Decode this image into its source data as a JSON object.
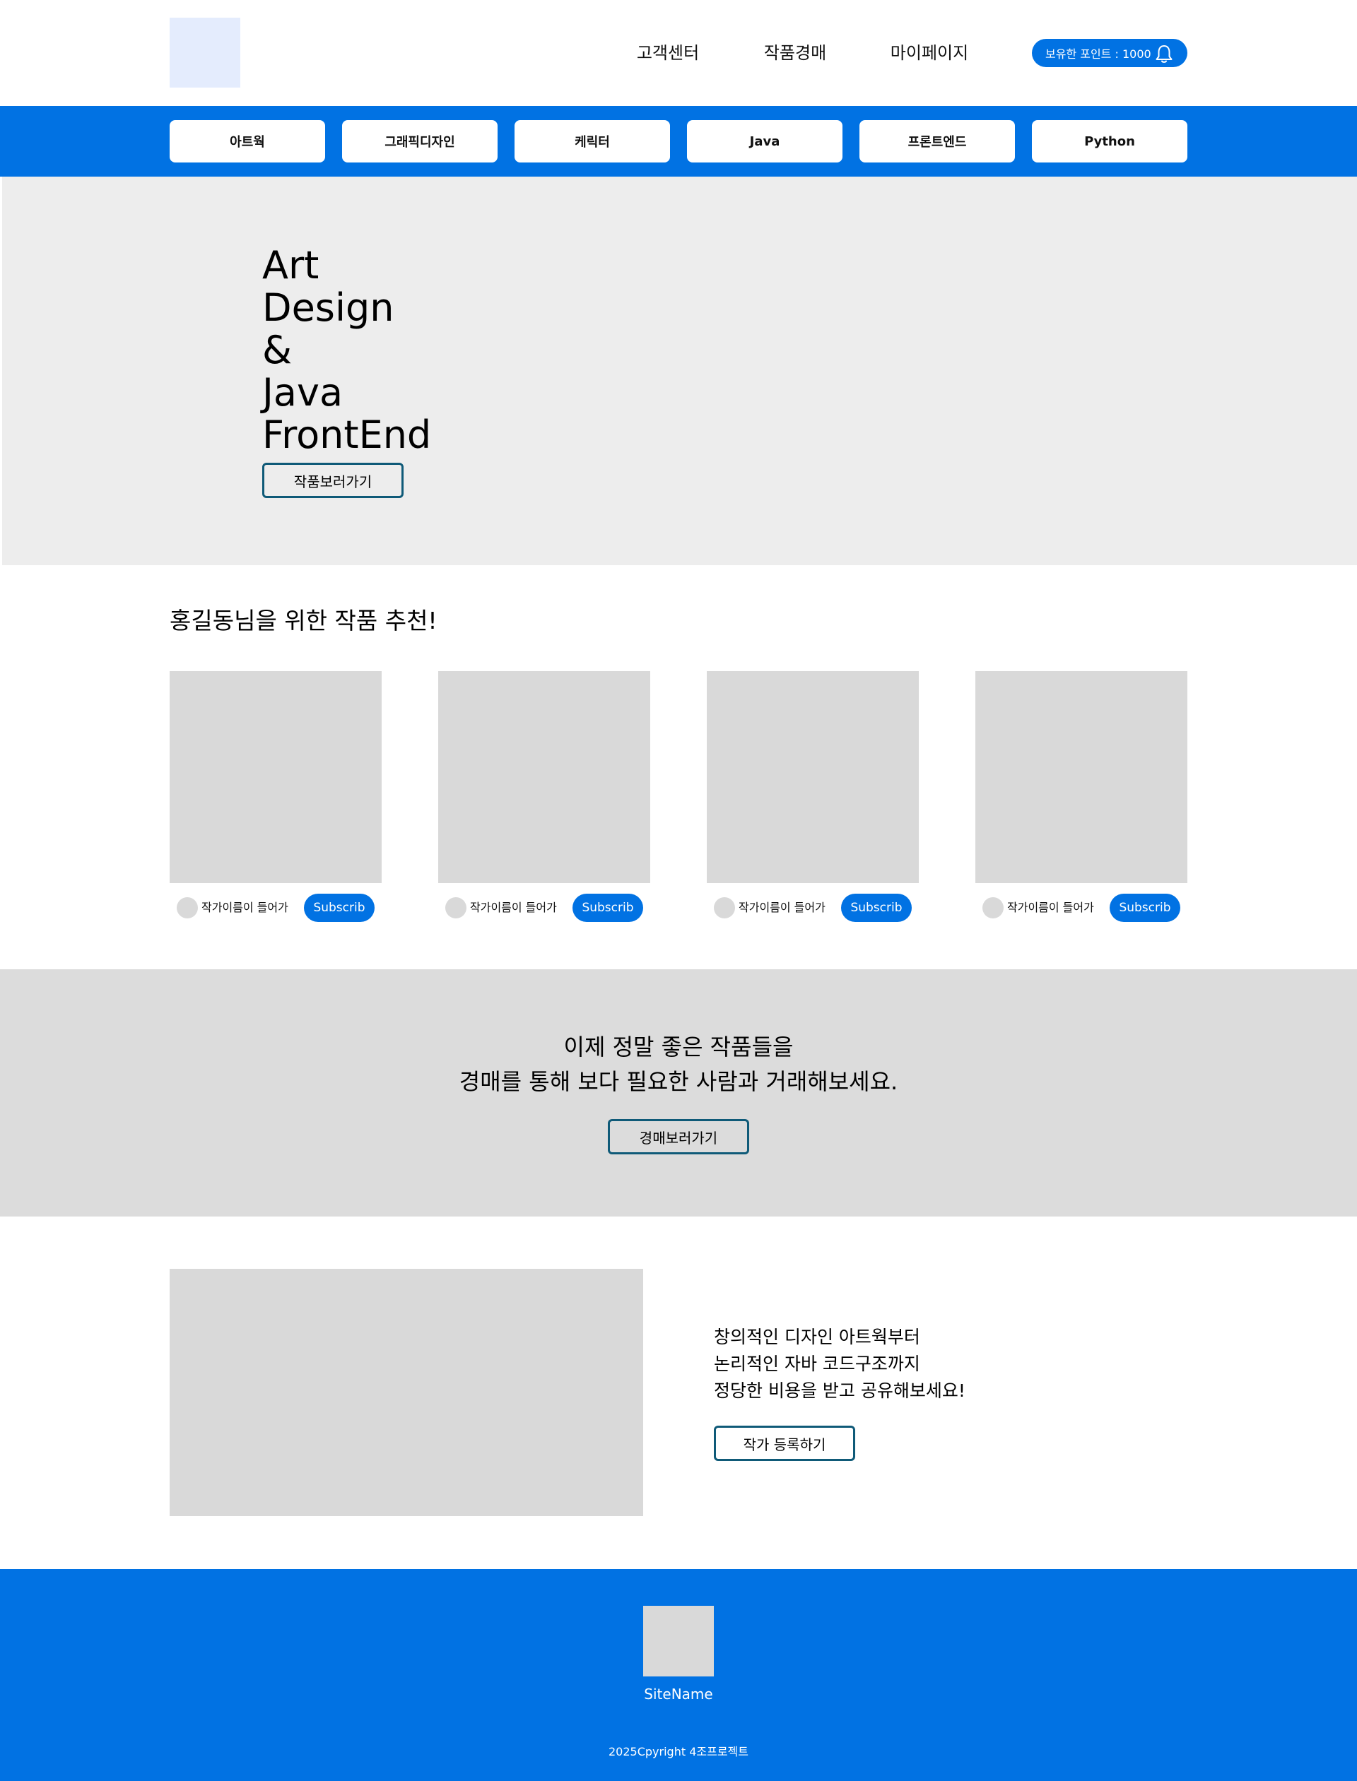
{
  "header": {
    "nav": [
      "고객센터",
      "작품경매",
      "마이페이지"
    ],
    "points_label": "보유한 포인트 : 1000",
    "bell_icon": "bell-icon"
  },
  "categories": [
    "아트웍",
    "그래픽디자인",
    "케릭터",
    "Java",
    "프론트엔드",
    "Python"
  ],
  "hero": {
    "lines": [
      "Art",
      "Design",
      "&",
      "Java",
      "FrontEnd"
    ],
    "button": "작품보러가기"
  },
  "recommendations": {
    "title": "홍길동님을 위한 작품 추천!",
    "cards": [
      {
        "author": "작가이름이 들어가",
        "button": "Subscrib"
      },
      {
        "author": "작가이름이 들어가",
        "button": "Subscrib"
      },
      {
        "author": "작가이름이 들어가",
        "button": "Subscrib"
      },
      {
        "author": "작가이름이 들어가",
        "button": "Subscrib"
      }
    ]
  },
  "auction": {
    "line1": "이제 정말 좋은 작품들을",
    "line2": "경매를 통해 보다 필요한 사람과 거래해보세요.",
    "button": "경매보러가기"
  },
  "promo": {
    "lines": [
      "창의적인 디자인 아트웍부터",
      "논리적인 자바 코드구조까지",
      "정당한 비용을 받고 공유해보세요!"
    ],
    "button": "작가 등록하기"
  },
  "footer": {
    "site_name": "SiteName",
    "copyright": "2025Cpyright 4조프로젝트"
  },
  "colors": {
    "primary": "#0172e3",
    "hero_bg": "#ededed",
    "banner_bg": "#dcdcdc",
    "placeholder": "#d9d9d9",
    "outline_button": "#0f5a78"
  }
}
